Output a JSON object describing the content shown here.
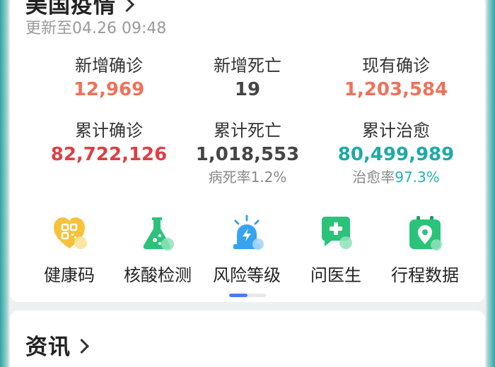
{
  "header": {
    "title": "美国疫情",
    "updated": "更新至04.26 09:48"
  },
  "stats": [
    {
      "label": "新增确诊",
      "value": "12,969"
    },
    {
      "label": "新增死亡",
      "value": "19"
    },
    {
      "label": "现有确诊",
      "value": "1,203,584"
    },
    {
      "label": "累计确诊",
      "value": "82,722,126"
    },
    {
      "label": "累计死亡",
      "value": "1,018,553",
      "sub_label": "病死率",
      "sub_value": "1.2%"
    },
    {
      "label": "累计治愈",
      "value": "80,499,989",
      "sub_label": "治愈率",
      "sub_value": "97.3%"
    }
  ],
  "services": [
    {
      "label": "健康码",
      "icon": "health-code-icon"
    },
    {
      "label": "核酸检测",
      "icon": "flask-icon"
    },
    {
      "label": "风险等级",
      "icon": "alarm-icon"
    },
    {
      "label": "问医生",
      "icon": "doctor-chat-icon"
    },
    {
      "label": "行程数据",
      "icon": "itinerary-icon"
    }
  ],
  "news": {
    "title": "资讯"
  },
  "colors": {
    "orange": "#f0715a",
    "red": "#dc3f45",
    "teal": "#1fa9a9",
    "green": "#2bc27a",
    "pager_active": "#4a7df0"
  }
}
